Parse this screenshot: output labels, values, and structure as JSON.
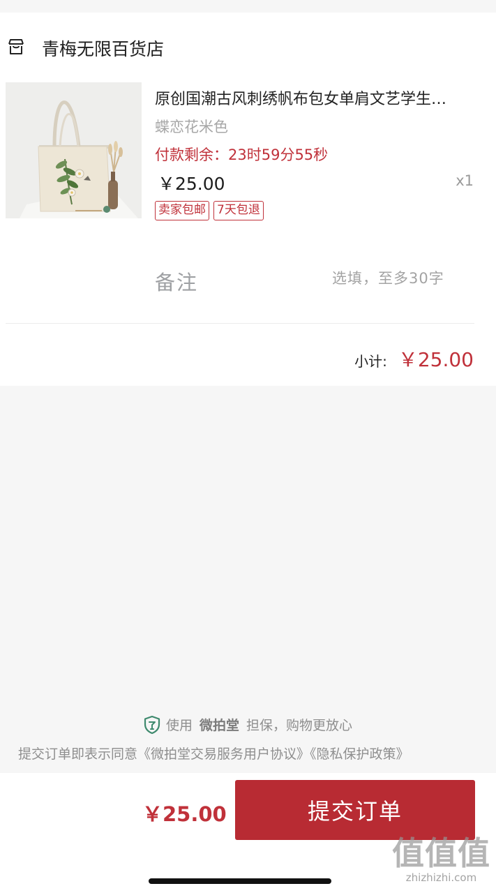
{
  "store": {
    "name": "青梅无限百货店"
  },
  "product": {
    "title": "原创国潮古风刺绣帆布包女单肩文艺学生…",
    "variant": "蝶恋花米色",
    "countdown": "付款剩余：23时59分55秒",
    "price": "￥25.00",
    "quantity": "x1",
    "tags": [
      "卖家包邮",
      "7天包退"
    ]
  },
  "remark": {
    "label": "备注",
    "placeholder": "选填，至多30字"
  },
  "subtotal": {
    "label": "小计:",
    "value": "￥25.00"
  },
  "guarantee": {
    "prefix": "使用",
    "brand": "微拍堂",
    "suffix": "担保，购物更放心"
  },
  "agreement": {
    "text": "提交订单即表示同意",
    "terms_link": "《微拍堂交易服务用户协议》",
    "privacy_link": "《隐私保护政策》"
  },
  "footer": {
    "total": "￥25.00",
    "submit_label": "提交订单"
  },
  "watermark": {
    "main": "值值值",
    "sub": "zhizhizhi.com"
  },
  "colors": {
    "accent": "#c0313a",
    "button": "#b82b33",
    "shield": "#3f8a6e"
  },
  "icons": {
    "store": "store-icon",
    "guarantee": "shield-icon"
  }
}
